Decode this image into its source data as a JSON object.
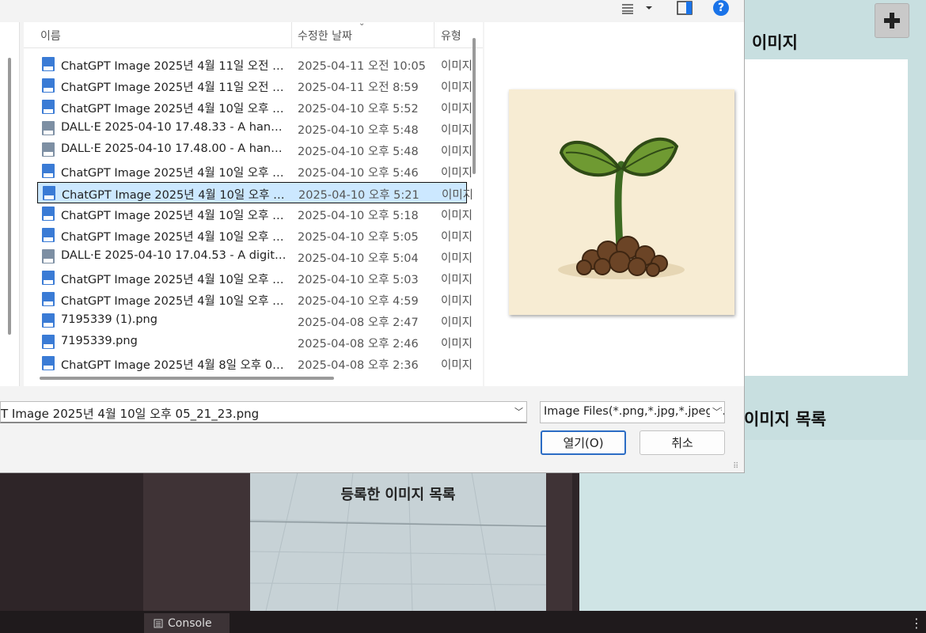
{
  "background_app": {
    "panel_title_top": "등록한 이미지",
    "panel_title_top_visible": "이미지",
    "panel_title_bottom_visible": "이미지 목록",
    "scene_title": "등록한 이미지 목록",
    "console_tab": "Console"
  },
  "dialog": {
    "columns": {
      "name": "이름",
      "modified": "수정한 날짜",
      "type": "유형"
    },
    "files": [
      {
        "name": "ChatGPT Image 2025년 4월 11일 오전 1...",
        "date": "2025-04-11 오전 10:05",
        "type": "이미지",
        "icon": "png-file-icon"
      },
      {
        "name": "ChatGPT Image 2025년 4월 11일 오전 0...",
        "date": "2025-04-11 오전 8:59",
        "type": "이미지",
        "icon": "png-file-icon"
      },
      {
        "name": "ChatGPT Image 2025년 4월 10일 오후 0...",
        "date": "2025-04-10 오후 5:52",
        "type": "이미지",
        "icon": "png-file-icon"
      },
      {
        "name": "DALL·E 2025-04-10 17.48.33 - A hand-dr...",
        "date": "2025-04-10 오후 5:48",
        "type": "이미지",
        "icon": "webp-file-icon"
      },
      {
        "name": "DALL·E 2025-04-10 17.48.00 - A hand-dr...",
        "date": "2025-04-10 오후 5:48",
        "type": "이미지",
        "icon": "webp-file-icon"
      },
      {
        "name": "ChatGPT Image 2025년 4월 10일 오후 0...",
        "date": "2025-04-10 오후 5:46",
        "type": "이미지",
        "icon": "png-file-icon"
      },
      {
        "name": "ChatGPT Image 2025년 4월 10일 오후 0...",
        "date": "2025-04-10 오후 5:21",
        "type": "이미지",
        "icon": "png-file-icon",
        "selected": true
      },
      {
        "name": "ChatGPT Image 2025년 4월 10일 오후 0...",
        "date": "2025-04-10 오후 5:18",
        "type": "이미지",
        "icon": "png-file-icon"
      },
      {
        "name": "ChatGPT Image 2025년 4월 10일 오후 0...",
        "date": "2025-04-10 오후 5:05",
        "type": "이미지",
        "icon": "png-file-icon"
      },
      {
        "name": "DALL·E 2025-04-10 17.04.53 - A digital il...",
        "date": "2025-04-10 오후 5:04",
        "type": "이미지",
        "icon": "webp-file-icon"
      },
      {
        "name": "ChatGPT Image 2025년 4월 10일 오후 0...",
        "date": "2025-04-10 오후 5:03",
        "type": "이미지",
        "icon": "png-file-icon"
      },
      {
        "name": "ChatGPT Image 2025년 4월 10일 오후 0...",
        "date": "2025-04-10 오후 4:59",
        "type": "이미지",
        "icon": "png-file-icon"
      },
      {
        "name": "7195339 (1).png",
        "date": "2025-04-08 오후 2:47",
        "type": "이미지",
        "icon": "png-file-icon"
      },
      {
        "name": "7195339.png",
        "date": "2025-04-08 오후 2:46",
        "type": "이미지",
        "icon": "png-file-icon"
      },
      {
        "name": "ChatGPT Image 2025년 4월 8일 오후 02...",
        "date": "2025-04-08 오후 2:36",
        "type": "이미지",
        "icon": "png-file-icon"
      }
    ],
    "filename_value": "T Image 2025년 4월 10일 오후 05_21_23.png",
    "filetype_value": "Image Files(*.png,*.jpg,*.jpeg,*.j",
    "open_button": "열기(O)",
    "cancel_button": "취소",
    "help_icon": "?",
    "colors": {
      "selection": "#cce8ff",
      "accent": "#2b6cc4",
      "help": "#1a73e8"
    }
  }
}
